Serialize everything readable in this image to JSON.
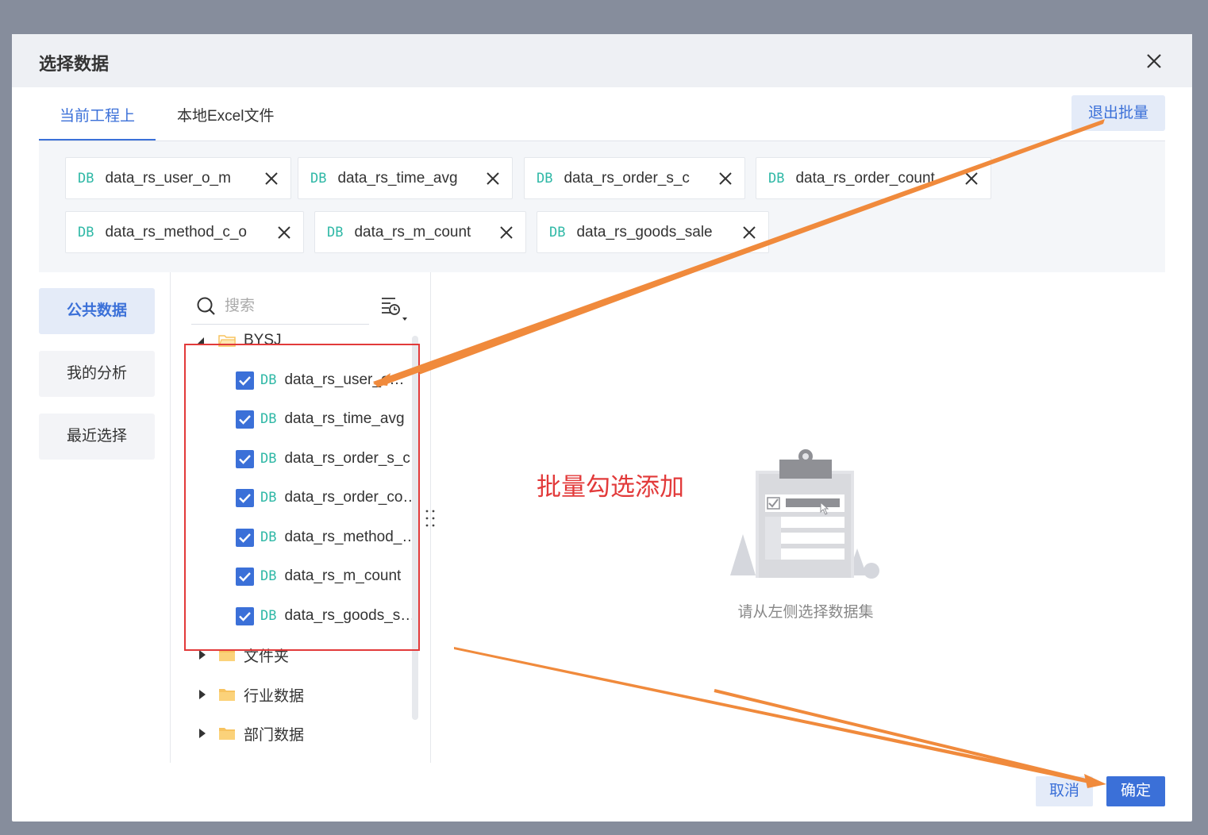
{
  "dialog": {
    "title": "选择数据",
    "close_icon": "close-icon"
  },
  "tabs": [
    {
      "label": "当前工程上",
      "active": true
    },
    {
      "label": "本地Excel文件",
      "active": false
    }
  ],
  "exit_batch_label": "退出批量",
  "db_badge": "DB",
  "chips": [
    {
      "label": "data_rs_user_o_m"
    },
    {
      "label": "data_rs_time_avg"
    },
    {
      "label": "data_rs_order_s_c"
    },
    {
      "label": "data_rs_order_count"
    },
    {
      "label": "data_rs_method_c_o"
    },
    {
      "label": "data_rs_m_count"
    },
    {
      "label": "data_rs_goods_sale"
    }
  ],
  "left_nav": [
    {
      "label": "公共数据",
      "active": true
    },
    {
      "label": "我的分析",
      "active": false
    },
    {
      "label": "最近选择",
      "active": false
    }
  ],
  "search": {
    "placeholder": "搜索"
  },
  "tree": {
    "root": "BYSJ",
    "checked_items": [
      "data_rs_user_o_m",
      "data_rs_time_avg",
      "data_rs_order_s_c",
      "data_rs_order_count",
      "data_rs_method_c_o",
      "data_rs_m_count",
      "data_rs_goods_sale"
    ],
    "folders": [
      "文件夹",
      "行业数据",
      "部门数据"
    ]
  },
  "annotation": "批量勾选添加",
  "empty_state": {
    "text": "请从左侧选择数据集"
  },
  "footer": {
    "cancel": "取消",
    "ok": "确定"
  },
  "colors": {
    "accent": "#3b70d8",
    "db_badge": "#2fb8a6",
    "annotation": "#e23a3a",
    "arrow": "#f08a3c",
    "folder": "#f7c35f"
  }
}
